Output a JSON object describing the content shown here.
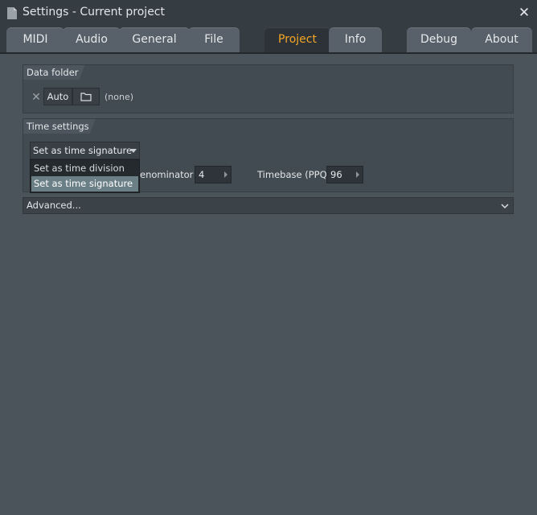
{
  "window": {
    "title": "Settings - Current project",
    "close_glyph": "✕"
  },
  "tabs": [
    {
      "label": "MIDI",
      "active": false
    },
    {
      "label": "Audio",
      "active": false
    },
    {
      "label": "General",
      "active": false
    },
    {
      "label": "File",
      "active": false
    },
    {
      "label": "Project",
      "active": true
    },
    {
      "label": "Info",
      "active": false
    },
    {
      "label": "Debug",
      "active": false
    },
    {
      "label": "About",
      "active": false
    }
  ],
  "colors": {
    "accent_active_tab": "#f5a623",
    "background": "#4b535b",
    "titlebar": "#353c42"
  },
  "data_folder": {
    "header": "Data folder",
    "clear_glyph": "✕",
    "auto_label": "Auto",
    "folder_icon": "folder-icon",
    "value": "(none)"
  },
  "time_settings": {
    "header": "Time settings",
    "mode_select_value": "Set as time signature",
    "denominator_label": "enominator",
    "denominator_value": "4",
    "timebase_label": "Timebase (PPQ)",
    "timebase_value": "96",
    "dropdown_options": [
      {
        "label": "Set as time division",
        "selected": false
      },
      {
        "label": "Set as time signature",
        "selected": true
      }
    ]
  },
  "advanced": {
    "label": "Advanced..."
  }
}
